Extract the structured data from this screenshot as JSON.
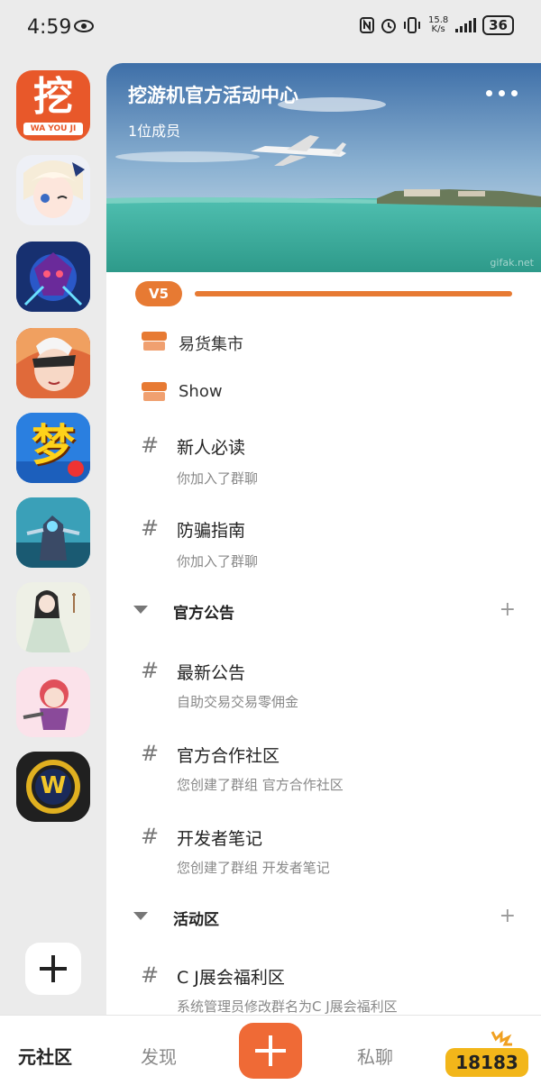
{
  "status_bar": {
    "time": "4:59",
    "net_speed_top": "15.8",
    "net_speed_bottom": "K/s",
    "battery": "36"
  },
  "sidebar": {
    "items": [
      {
        "name": "wayouji-app",
        "label_main": "挖",
        "label_sub": "WA YOU JI"
      },
      {
        "name": "anime-girl-community"
      },
      {
        "name": "hero-community"
      },
      {
        "name": "warrior-community"
      },
      {
        "name": "meng-community",
        "label_main": "梦"
      },
      {
        "name": "mech-community"
      },
      {
        "name": "ancient-lady-community"
      },
      {
        "name": "pink-hair-community"
      },
      {
        "name": "wow-community",
        "label_main": "W"
      }
    ]
  },
  "header": {
    "title": "挖游机官方活动中心",
    "members": "1位成员",
    "watermark": "gifak.net"
  },
  "level": {
    "badge": "V5",
    "progress": 1.0
  },
  "quick_links": [
    {
      "label": "易货集市"
    },
    {
      "label": "Show"
    }
  ],
  "channels_top": [
    {
      "name": "新人必读",
      "sub": "你加入了群聊"
    },
    {
      "name": "防骗指南",
      "sub": "你加入了群聊"
    }
  ],
  "section_1": {
    "name": "官方公告",
    "channels": [
      {
        "name": "最新公告",
        "sub": "自助交易交易零佣金"
      },
      {
        "name": "官方合作社区",
        "sub": "您创建了群组 官方合作社区"
      },
      {
        "name": "开发者笔记",
        "sub": "您创建了群组 开发者笔记"
      }
    ]
  },
  "section_2": {
    "name": "活动区",
    "channels": [
      {
        "name": "C J展会福利区",
        "sub": "系统管理员修改群名为C J展会福利区"
      }
    ]
  },
  "bottom_nav": {
    "home": "元社区",
    "discover": "发现",
    "chat": "私聊",
    "logo": "18183"
  },
  "colors": {
    "accent": "#e77a33",
    "nav_add": "#ef6a36"
  }
}
